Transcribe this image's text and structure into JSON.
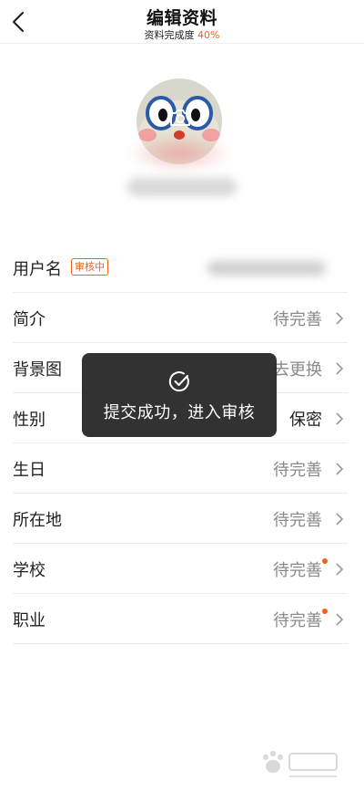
{
  "header": {
    "title": "编辑资料",
    "completion_label": "资料完成度",
    "completion_value": "40%"
  },
  "rows": [
    {
      "label": "用户名",
      "badge": "审核中"
    },
    {
      "label": "简介",
      "value": "待完善"
    },
    {
      "label": "背景图",
      "value": "去更换"
    },
    {
      "label": "性别",
      "value": "保密"
    },
    {
      "label": "生日",
      "value": "待完善"
    },
    {
      "label": "所在地",
      "value": "待完善"
    },
    {
      "label": "学校",
      "value": "待完善"
    },
    {
      "label": "职业",
      "value": "待完善"
    }
  ],
  "toast": {
    "message": "提交成功，进入审核"
  },
  "colors": {
    "accent": "#f0621e",
    "toast_bg": "#222222",
    "muted_text": "#8a8a8a"
  },
  "icons": {
    "back": "chevron-left-icon",
    "camera": "camera-icon",
    "check": "check-circle-icon",
    "chevron": "chevron-right-icon"
  }
}
